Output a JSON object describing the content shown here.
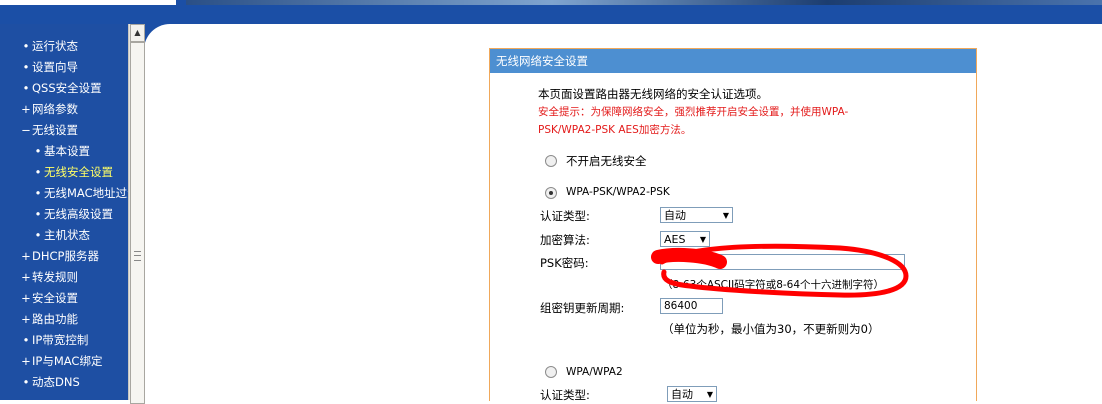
{
  "sidebar": {
    "items": [
      {
        "bullet": "•",
        "label": "运行状态"
      },
      {
        "bullet": "•",
        "label": "设置向导"
      },
      {
        "bullet": "•",
        "label": "QSS安全设置"
      },
      {
        "bullet": "+",
        "label": "网络参数"
      },
      {
        "bullet": "−",
        "label": "无线设置"
      },
      {
        "bullet": "•",
        "label": "基本设置"
      },
      {
        "bullet": "•",
        "label": "无线安全设置"
      },
      {
        "bullet": "•",
        "label": "无线MAC地址过滤"
      },
      {
        "bullet": "•",
        "label": "无线高级设置"
      },
      {
        "bullet": "•",
        "label": "主机状态"
      },
      {
        "bullet": "+",
        "label": "DHCP服务器"
      },
      {
        "bullet": "+",
        "label": "转发规则"
      },
      {
        "bullet": "+",
        "label": "安全设置"
      },
      {
        "bullet": "+",
        "label": "路由功能"
      },
      {
        "bullet": "•",
        "label": "IP带宽控制"
      },
      {
        "bullet": "+",
        "label": "IP与MAC绑定"
      },
      {
        "bullet": "•",
        "label": "动态DNS"
      }
    ]
  },
  "scrollbar": {
    "up_arrow": "▲"
  },
  "panel": {
    "title": "无线网络安全设置",
    "intro": "本页面设置路由器无线网络的安全认证选项。",
    "warning_line1": "安全提示：为保障网络安全，强烈推荐开启安全设置，并使用WPA-",
    "warning_line2": "PSK/WPA2-PSK AES加密方法。",
    "option_off_label": "不开启无线安全",
    "option_psk_label": "WPA-PSK/WPA2-PSK",
    "auth_type_label": "认证类型:",
    "auth_type_value": "自动",
    "encryption_label": "加密算法:",
    "encryption_value": "AES",
    "psk_label": "PSK密码:",
    "psk_hint": "（8-63个ASCII码字符或8-64个十六进制字符）",
    "renew_label": "组密钥更新周期:",
    "renew_value": "86400",
    "renew_hint": "（单位为秒，最小值为30，不更新则为0）",
    "option_wpa_label": "WPA/WPA2",
    "wpa_auth_type_label": "认证类型:",
    "wpa_auth_type_value": "自动"
  },
  "colors": {
    "sidebar_bg": "#1e4fa3",
    "panel_title_bg": "#4d8fd1",
    "panel_border": "#f0a85a",
    "warning_text": "#e31a1a",
    "annotation": "#ff0000"
  }
}
